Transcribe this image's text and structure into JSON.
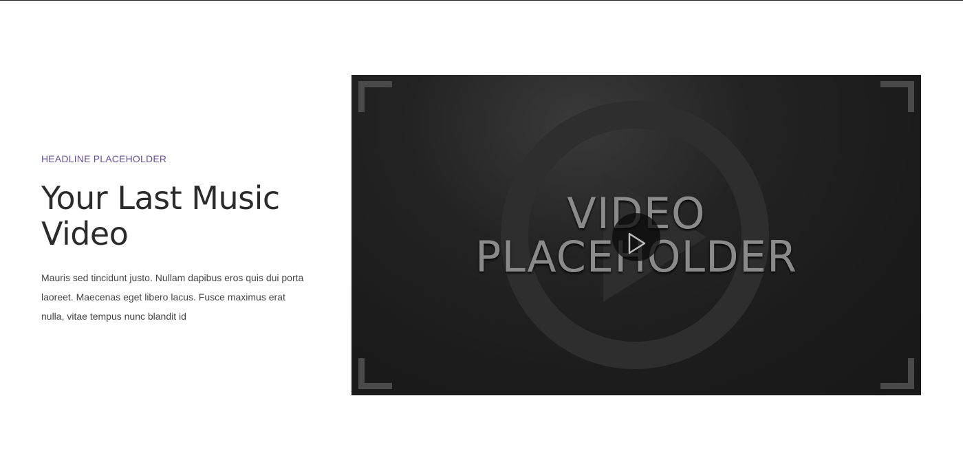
{
  "section": {
    "eyebrow": "HEADLINE PLACEHOLDER",
    "title": "Your Last Music Video",
    "body": "Mauris sed tincidunt justo. Nullam dapibus eros quis dui porta laoreet. Maecenas eget libero lacus. Fusce maximus erat nulla, vitae tempus nunc blandit id"
  },
  "video": {
    "placeholder_line1": "VIDEO",
    "placeholder_line2": "PLACEHOLDER",
    "play_icon": "play-icon"
  },
  "colors": {
    "accent": "#6a4f9a",
    "heading": "#2b2b2b",
    "body": "#444444",
    "video_bg": "#1b1b1b"
  }
}
